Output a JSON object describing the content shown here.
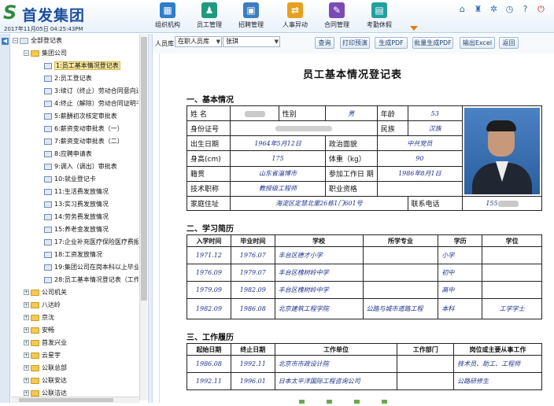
{
  "header": {
    "logo_mark": "S",
    "logo_text": "首发集团",
    "datetime": "2017年11月05日  04:25:43PM",
    "nav": [
      {
        "label": "组织机构",
        "icon": "org-chart-icon",
        "color": "#2f7dc8",
        "glyph": "▦"
      },
      {
        "label": "员工管理",
        "icon": "staff-icon",
        "color": "#1f9a7c",
        "glyph": "♟"
      },
      {
        "label": "招聘管理",
        "icon": "recruit-icon",
        "color": "#3c7fc0",
        "glyph": "▣"
      },
      {
        "label": "人事异动",
        "icon": "transfer-icon",
        "color": "#e8a020",
        "glyph": "⇄"
      },
      {
        "label": "合同管理",
        "icon": "contract-icon",
        "color": "#7b4bb5",
        "glyph": "✎"
      },
      {
        "label": "考勤休假",
        "icon": "attendance-icon",
        "color": "#22a0a0",
        "glyph": "▤"
      }
    ],
    "right_icons": [
      "home-icon",
      "shirt-icon",
      "gear-icon",
      "clock-icon",
      "help-icon",
      "power-icon"
    ]
  },
  "tree": {
    "root": "全部登记表",
    "group": "集团公司",
    "items": [
      "1:员工基本情况登记表",
      "2:员工登记表",
      "3:续订（终止）劳动合同意向送",
      "4:终止（解除）劳动合同证明书",
      "5:薪酬初次核定审批表",
      "6:薪资变动审批表（一）",
      "7:薪资变动审批表（二）",
      "8:应聘申请表",
      "9:调入（调出）审批表",
      "10:就业登记卡",
      "11:生活费发放情况",
      "13:实习费发放情况",
      "14:劳务费发放情况",
      "15:养老金发放情况",
      "17:企业补充医疗保险医疗费报",
      "18:工资发放情况",
      "19:集团公司在岗本科以上毕业",
      "28:员工基本情况登记表（工作"
    ],
    "folders": [
      "公司机关",
      "八达岭",
      "京沈",
      "安畅",
      "首发兴业",
      "云星宇",
      "公联总部",
      "公联安达",
      "公联洁达",
      "公联交通"
    ]
  },
  "toolbar": {
    "label": "人员库",
    "scope": "在职人员库",
    "person": "张琪",
    "buttons": [
      "查询",
      "打印预演",
      "生成PDF",
      "批量生成PDF",
      "输出Excel",
      "返回"
    ]
  },
  "form": {
    "title": "员工基本情况登记表",
    "sec1": "一、基本情况",
    "sec2": "二、学习简历",
    "sec3": "三、工作履历",
    "labels": {
      "name": "姓   名",
      "gender": "性别",
      "age": "年龄",
      "id": "身份证号",
      "ethnic": "民族",
      "birth": "出生日期",
      "political": "政治面貌",
      "height": "身高(cm)",
      "weight": "体重（kg）",
      "origin": "籍贯",
      "workdate": "参加工作日   期",
      "title": "技术职称",
      "qual": "职业资格",
      "address": "家庭住址",
      "phone": "联系电话"
    },
    "values": {
      "gender": "男",
      "age": "53",
      "ethnic": "汉族",
      "birth": "1964年5月12日",
      "political": "中共党员",
      "height": "175",
      "weight": "90",
      "origin": "山东省淄博市",
      "workdate": "1986年8月1日",
      "title": "教授级工程师",
      "qual": "",
      "address": "海淀区定慧北里26栋1门601号",
      "phone": "155"
    },
    "study_headers": [
      "入学时间",
      "毕业时间",
      "学校",
      "所学专业",
      "学历",
      "学位"
    ],
    "study_rows": [
      [
        "1971.12",
        "1976.07",
        "丰台区德才小学",
        "",
        "小学",
        ""
      ],
      [
        "1976.09",
        "1979.07",
        "丰台区槐树岭中学",
        "",
        "初中",
        ""
      ],
      [
        "1979.09",
        "1982.09",
        "丰台区槐树岭中学",
        "",
        "高中",
        ""
      ],
      [
        "1982.09",
        "1986.08",
        "北京建筑工程学院",
        "公路与城市道路工程",
        "本科",
        "工学学士"
      ]
    ],
    "work_headers": [
      "起始日期",
      "终止日期",
      "工作单位",
      "工作部门",
      "岗位或主要从事工作"
    ],
    "work_rows": [
      [
        "1986.08",
        "1992.11",
        "北京市市政设计院",
        "",
        "技术员、助工、工程师"
      ],
      [
        "1992.11",
        "1996.01",
        "日本太平洋国际工程咨询公司",
        "",
        "公路研修生"
      ]
    ]
  }
}
